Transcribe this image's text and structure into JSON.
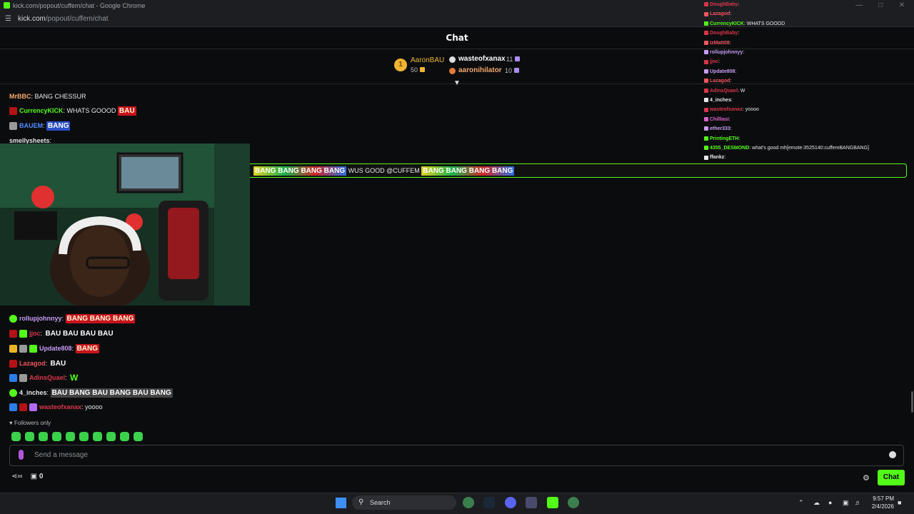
{
  "window": {
    "title": "kick.com/popout/cuffem/chat - Google Chrome",
    "url_host": "kick.com",
    "url_path": "/popout/cuffem/chat"
  },
  "chat": {
    "title": "Chat"
  },
  "leaderboard": {
    "rank1_badge": "1",
    "entries": [
      {
        "name": "AaronBAU",
        "count": "50"
      },
      {
        "name": "wasteofxanax",
        "count": "11"
      },
      {
        "name": "aaronihilator",
        "count": "10"
      }
    ]
  },
  "messages_top": [
    {
      "user": "MrBBC",
      "text": ": BANG CHESSUR",
      "color": "#f3a96b"
    },
    {
      "user": "CurrencyKICK",
      "text": ": WHATS GOOOD",
      "color": "#53fc18",
      "emote": "BAU"
    },
    {
      "user": "BAUEM",
      "text": ":",
      "color": "#4d8cff",
      "emote": "BANG"
    },
    {
      "user": "smellysheets",
      "text": ":",
      "color": "#e7e8ea"
    }
  ],
  "pinned": {
    "emotes_left": "BANG BANG BANG BANG",
    "text": "WUS GOOD @CUFFEM",
    "emotes_right": "BANG BANG BANG BANG"
  },
  "messages_bottom": [
    {
      "user": "rollupjohnnyy",
      "text": ":",
      "color": "#c89cf7",
      "emote": "BANG BANG BANG"
    },
    {
      "user": "jjoc",
      "text": ":",
      "color": "#d9364a",
      "emote": "BAU BAU BAU BAU"
    },
    {
      "user": "Update808",
      "text": ":",
      "color": "#c89cf7",
      "emote": "BANG"
    },
    {
      "user": "Lazagod",
      "text": ":",
      "color": "#f2565d",
      "emote": "BAU"
    },
    {
      "user": "AdinsQuael",
      "text": ":",
      "color": "#d9364a",
      "emote": "W"
    },
    {
      "user": "4_inches",
      "text": ":",
      "color": "#e7e8ea",
      "emote": "BAU BANG BAU BANG BAU BANG"
    },
    {
      "user": "wasteofxanax",
      "text": ": yoooo",
      "color": "#d9364a"
    }
  ],
  "overlay_chat": [
    {
      "user": "DoughBaby",
      "text": ":",
      "color": "#d9364a"
    },
    {
      "user": "Lazagod",
      "text": ":",
      "color": "#f2565d"
    },
    {
      "user": "CurrencyKICK",
      "text": ": WHATS GOOOD",
      "color": "#53fc18"
    },
    {
      "user": "DoughBaby",
      "text": ":",
      "color": "#d9364a"
    },
    {
      "user": "IzMatt08",
      "text": ":",
      "color": "#f2565d"
    },
    {
      "user": "rollupjohnnyy",
      "text": ":",
      "color": "#c89cf7"
    },
    {
      "user": "jjoc",
      "text": ":",
      "color": "#d9364a"
    },
    {
      "user": "Update808",
      "text": ":",
      "color": "#c89cf7"
    },
    {
      "user": "Lazagod",
      "text": ":",
      "color": "#f2565d"
    },
    {
      "user": "AdinsQuael",
      "text": ": W",
      "color": "#d9364a"
    },
    {
      "user": "4_inches",
      "text": ":",
      "color": "#e7e8ea"
    },
    {
      "user": "wasteofxanax",
      "text": ": yoooo",
      "color": "#d9364a"
    },
    {
      "user": "Chilliasi",
      "text": ":",
      "color": "#d963c9"
    },
    {
      "user": "ether333",
      "text": ":",
      "color": "#c89cf7"
    },
    {
      "user": "PrintingETH",
      "text": ":",
      "color": "#53fc18"
    },
    {
      "user": "4355_DESMOND",
      "text": ": what's good mh[emote:3525140:cuffemBANGBANG]",
      "color": "#53fc18"
    },
    {
      "user": "ffankz",
      "text": ":",
      "color": "#e7e8ea"
    }
  ],
  "footer": {
    "followers_only": "Followers only",
    "input_placeholder": "Send a message",
    "counter": "0",
    "chat_button": "Chat"
  },
  "taskbar": {
    "search_label": "Search",
    "time": "9:57 PM",
    "date": "2/4/2026"
  },
  "colors": {
    "accent": "#53fc18",
    "bg": "#0b0c0e"
  },
  "icons": [
    "kick-logo-icon",
    "site-info-icon",
    "collapse-icon",
    "mic-icon",
    "emoji-icon",
    "gear-icon",
    "gift-icon",
    "windows-start-icon",
    "search-icon"
  ]
}
